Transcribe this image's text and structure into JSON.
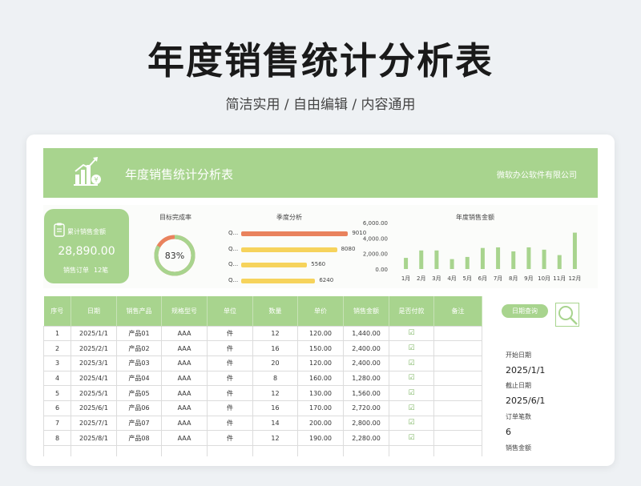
{
  "header": {
    "title": "年度销售统计分析表",
    "subtitle": "简洁实用 / 自由编辑 / 内容通用"
  },
  "banner": {
    "title": "年度销售统计分析表",
    "company": "微软办公软件有限公司"
  },
  "kpi": {
    "label": "累计销售金额",
    "value": "28,890.00",
    "orders_label": "销售订单",
    "orders_value": "12笔"
  },
  "target": {
    "title": "目标完成率",
    "percent_label": "83%",
    "percent": 0.83
  },
  "quarters": {
    "title": "季度分析",
    "items": [
      {
        "label": "Q...",
        "value": 9010,
        "value_label": "9010",
        "color": "#e9825d"
      },
      {
        "label": "Q...",
        "value": 8080,
        "value_label": "8080",
        "color": "#f6d35c"
      },
      {
        "label": "Q...",
        "value": 5560,
        "value_label": "5560",
        "color": "#f6d35c"
      },
      {
        "label": "Q...",
        "value": 6240,
        "value_label": "6240",
        "color": "#f6d35c"
      }
    ],
    "max": 10000
  },
  "chart_data": {
    "type": "bar",
    "title": "年度销售金额",
    "categories": [
      "1月",
      "2月",
      "3月",
      "4月",
      "5月",
      "6月",
      "7月",
      "8月",
      "9月",
      "10月",
      "11月",
      "12月"
    ],
    "values": [
      1440,
      2400,
      2400,
      1280,
      1560,
      2720,
      2800,
      2280,
      2800,
      2500,
      1800,
      4700
    ],
    "yticks": [
      "0.00",
      "2,000.00",
      "4,000.00",
      "6,000.00"
    ],
    "ylim": [
      0,
      6000
    ],
    "color": "#a8d48e"
  },
  "table": {
    "columns": [
      "序号",
      "日期",
      "销售产品",
      "规格型号",
      "单位",
      "数量",
      "单价",
      "销售金额",
      "是否付款",
      "备注"
    ],
    "rows": [
      [
        "1",
        "2025/1/1",
        "产品01",
        "AAA",
        "件",
        "12",
        "120.00",
        "1,440.00",
        "☑",
        ""
      ],
      [
        "2",
        "2025/2/1",
        "产品02",
        "AAA",
        "件",
        "16",
        "150.00",
        "2,400.00",
        "☑",
        ""
      ],
      [
        "3",
        "2025/3/1",
        "产品03",
        "AAA",
        "件",
        "20",
        "120.00",
        "2,400.00",
        "☑",
        ""
      ],
      [
        "4",
        "2025/4/1",
        "产品04",
        "AAA",
        "件",
        "8",
        "160.00",
        "1,280.00",
        "☑",
        ""
      ],
      [
        "5",
        "2025/5/1",
        "产品05",
        "AAA",
        "件",
        "12",
        "130.00",
        "1,560.00",
        "☑",
        ""
      ],
      [
        "6",
        "2025/6/1",
        "产品06",
        "AAA",
        "件",
        "16",
        "170.00",
        "2,720.00",
        "☑",
        ""
      ],
      [
        "7",
        "2025/7/1",
        "产品07",
        "AAA",
        "件",
        "14",
        "200.00",
        "2,800.00",
        "☑",
        ""
      ],
      [
        "8",
        "2025/8/1",
        "产品08",
        "AAA",
        "件",
        "12",
        "190.00",
        "2,280.00",
        "☑",
        ""
      ],
      [
        "",
        "",
        "",
        "",
        "",
        "",
        "",
        "",
        "",
        ""
      ]
    ]
  },
  "side": {
    "query_button": "日期查询",
    "start_label": "开始日期",
    "start_value": "2025/1/1",
    "end_label": "截止日期",
    "end_value": "2025/6/1",
    "orders_label": "订单笔数",
    "orders_value": "6",
    "amount_label": "销售金额"
  }
}
